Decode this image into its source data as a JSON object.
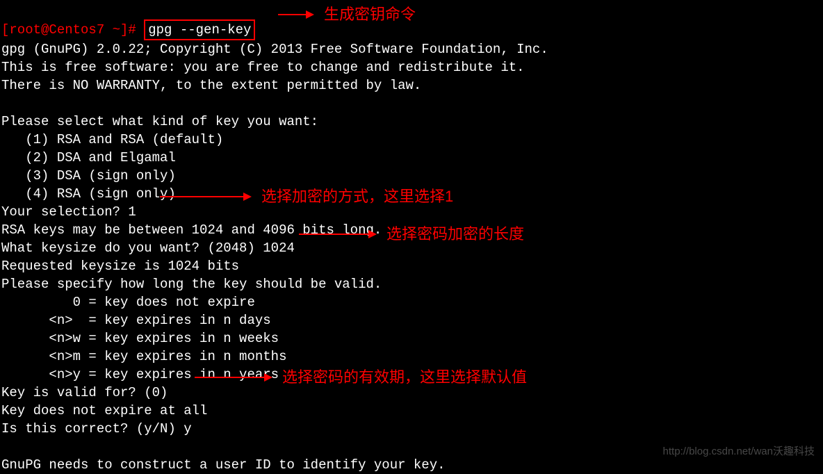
{
  "prompt": "[root@Centos7 ~]# ",
  "command": "gpg --gen-key",
  "lines": {
    "l1": "gpg (GnuPG) 2.0.22; Copyright (C) 2013 Free Software Foundation, Inc.",
    "l2": "This is free software: you are free to change and redistribute it.",
    "l3": "There is NO WARRANTY, to the extent permitted by law.",
    "l4": "",
    "l5": "Please select what kind of key you want:",
    "l6": "   (1) RSA and RSA (default)",
    "l7": "   (2) DSA and Elgamal",
    "l8": "   (3) DSA (sign only)",
    "l9": "   (4) RSA (sign only)",
    "l10": "Your selection? 1",
    "l11": "RSA keys may be between 1024 and 4096 bits long.",
    "l12": "What keysize do you want? (2048) 1024",
    "l13": "Requested keysize is 1024 bits",
    "l14": "Please specify how long the key should be valid.",
    "l15": "         0 = key does not expire",
    "l16": "      <n>  = key expires in n days",
    "l17": "      <n>w = key expires in n weeks",
    "l18": "      <n>m = key expires in n months",
    "l19": "      <n>y = key expires in n years",
    "l20": "Key is valid for? (0)",
    "l21": "Key does not expire at all",
    "l22": "Is this correct? (y/N) y",
    "l23": "",
    "l24": "GnuPG needs to construct a user ID to identify your key."
  },
  "annotations": {
    "a1": "生成密钥命令",
    "a2": "选择加密的方式，这里选择1",
    "a3": "选择密码加密的长度",
    "a4": "选择密码的有效期，这里选择默认值"
  },
  "watermark": "http://blog.csdn.net/wan沃趣科技"
}
